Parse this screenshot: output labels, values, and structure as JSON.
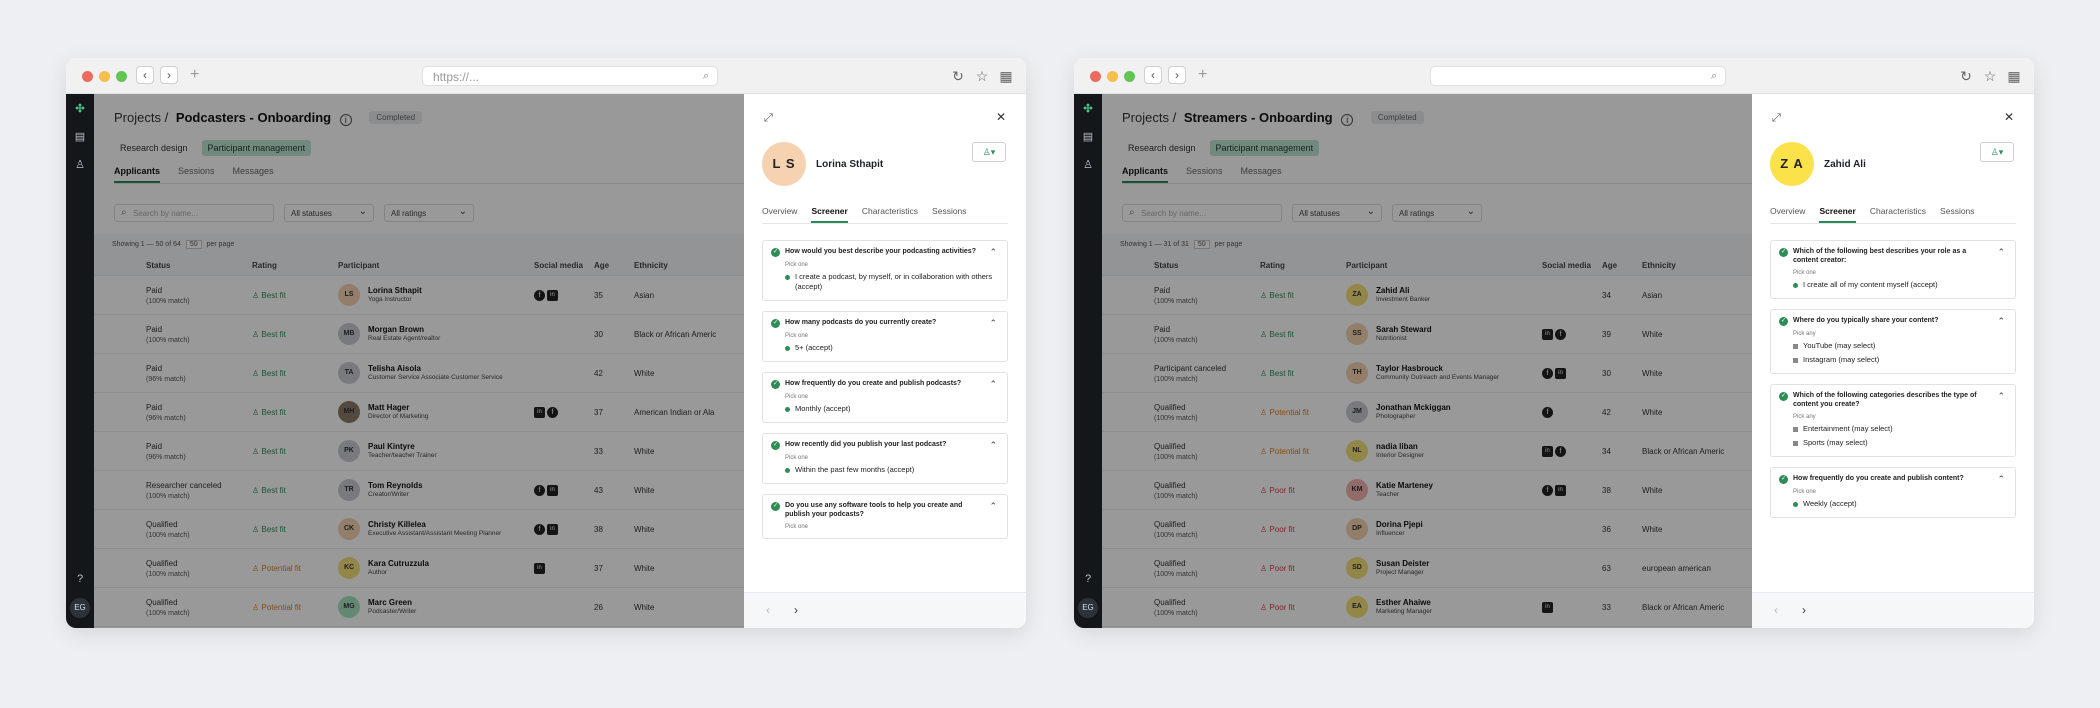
{
  "windows": [
    {
      "url": "https://...",
      "crumb": "Projects /",
      "project": "Podcasters - Onboarding",
      "badge": "Completed",
      "subtabs": [
        "Research design",
        "Participant management"
      ],
      "tabs": [
        "Applicants",
        "Sessions",
        "Messages"
      ],
      "search_placeholder": "Search by name...",
      "status_filter": "All statuses",
      "rating_filter": "All ratings",
      "showing": "Showing 1 — 50 of 64",
      "per_page_value": "50",
      "per_page_label": "per page",
      "columns": [
        "Status",
        "Rating",
        "Participant",
        "Social media",
        "Age",
        "Ethnicity"
      ],
      "rows": [
        {
          "status": "Paid",
          "match": "(100% match)",
          "rating": "Best fit",
          "rating_color": "#2f8c56",
          "initials": "LS",
          "avatar_color": "#f6d2b0",
          "name": "Lorina Sthapit",
          "role": "Yoga Instructor",
          "social": [
            "fb",
            "in"
          ],
          "age": "35",
          "ethnicity": "Asian"
        },
        {
          "status": "Paid",
          "match": "(100% match)",
          "rating": "Best fit",
          "rating_color": "#2f8c56",
          "initials": "MB",
          "avatar_color": "#c9cbd0",
          "name": "Morgan Brown",
          "role": "Real Estate Agent/realtor",
          "social": [],
          "age": "30",
          "ethnicity": "Black or African Americ"
        },
        {
          "status": "Paid",
          "match": "(96% match)",
          "rating": "Best fit",
          "rating_color": "#2f8c56",
          "initials": "TA",
          "avatar_color": "#c9cbd0",
          "name": "Telisha Aisola",
          "role": "Customer Service Associate Customer Service",
          "social": [],
          "age": "42",
          "ethnicity": "White"
        },
        {
          "status": "Paid",
          "match": "(96% match)",
          "rating": "Best fit",
          "rating_color": "#2f8c56",
          "initials": "MH",
          "avatar_color": "#8a7a6a",
          "name": "Matt Hager",
          "role": "Director of Marketing",
          "social": [
            "in",
            "fb"
          ],
          "age": "37",
          "ethnicity": "American Indian or Ala"
        },
        {
          "status": "Paid",
          "match": "(96% match)",
          "rating": "Best fit",
          "rating_color": "#2f8c56",
          "initials": "PK",
          "avatar_color": "#c9cbd0",
          "name": "Paul Kintyre",
          "role": "Teacher/teacher Trainer",
          "social": [],
          "age": "33",
          "ethnicity": "White"
        },
        {
          "status": "Researcher canceled",
          "match": "(100% match)",
          "rating": "Best fit",
          "rating_color": "#2f8c56",
          "initials": "TR",
          "avatar_color": "#c9cbd0",
          "name": "Tom Reynolds",
          "role": "Creator/Writer",
          "social": [
            "fb",
            "in"
          ],
          "age": "43",
          "ethnicity": "White"
        },
        {
          "status": "Qualified",
          "match": "(100% match)",
          "rating": "Best fit",
          "rating_color": "#2f8c56",
          "initials": "CK",
          "avatar_color": "#f6d2b0",
          "name": "Christy Killelea",
          "role": "Executive Assistant/Assistant Meeting Planner",
          "social": [
            "fb",
            "in"
          ],
          "age": "38",
          "ethnicity": "White"
        },
        {
          "status": "Qualified",
          "match": "(100% match)",
          "rating": "Potential fit",
          "rating_color": "#d9822b",
          "initials": "KC",
          "avatar_color": "#f5e07a",
          "name": "Kara Cutruzzula",
          "role": "Author",
          "social": [
            "in"
          ],
          "age": "37",
          "ethnicity": "White"
        },
        {
          "status": "Qualified",
          "match": "(100% match)",
          "rating": "Potential fit",
          "rating_color": "#d9822b",
          "initials": "MG",
          "avatar_color": "#a6e3bf",
          "name": "Marc Green",
          "role": "Podcaster/Writer",
          "social": [],
          "age": "26",
          "ethnicity": "White"
        }
      ],
      "panel": {
        "initials": "L S",
        "avatar_color": "#f6d2b0",
        "name": "Lorina Sthapit",
        "tabs": [
          "Overview",
          "Screener",
          "Characteristics",
          "Sessions"
        ],
        "questions": [
          {
            "q": "How would you best describe your podcasting activities?",
            "pick": "Pick one",
            "type": "one",
            "answers": [
              "I create a podcast, by myself, or in collaboration with others (accept)"
            ]
          },
          {
            "q": "How many podcasts do you currently create?",
            "pick": "Pick one",
            "type": "one",
            "answers": [
              "5+ (accept)"
            ]
          },
          {
            "q": "How frequently do you create and publish podcasts?",
            "pick": "Pick one",
            "type": "one",
            "answers": [
              "Monthly (accept)"
            ]
          },
          {
            "q": "How recently did you publish your last podcast?",
            "pick": "Pick one",
            "type": "one",
            "answers": [
              "Within the past few months (accept)"
            ]
          },
          {
            "q": "Do you use any software tools to help you create and publish your podcasts?",
            "pick": "Pick one",
            "type": "one",
            "answers": []
          }
        ]
      }
    },
    {
      "url": "",
      "crumb": "Projects /",
      "project": "Streamers - Onboarding",
      "badge": "Completed",
      "subtabs": [
        "Research design",
        "Participant management"
      ],
      "tabs": [
        "Applicants",
        "Sessions",
        "Messages"
      ],
      "search_placeholder": "Search by name...",
      "status_filter": "All statuses",
      "rating_filter": "All ratings",
      "showing": "Showing 1 — 31 of 31",
      "per_page_value": "50",
      "per_page_label": "per page",
      "columns": [
        "Status",
        "Rating",
        "Participant",
        "Social media",
        "Age",
        "Ethnicity"
      ],
      "rows": [
        {
          "status": "Paid",
          "match": "(100% match)",
          "rating": "Best fit",
          "rating_color": "#2f8c56",
          "initials": "ZA",
          "avatar_color": "#f5e07a",
          "name": "Zahid Ali",
          "role": "Investment Banker",
          "social": [],
          "age": "34",
          "ethnicity": "Asian"
        },
        {
          "status": "Paid",
          "match": "(100% match)",
          "rating": "Best fit",
          "rating_color": "#2f8c56",
          "initials": "SS",
          "avatar_color": "#f6d2b0",
          "name": "Sarah Steward",
          "role": "Nutritionist",
          "social": [
            "in",
            "fb"
          ],
          "age": "39",
          "ethnicity": "White"
        },
        {
          "status": "Participant canceled",
          "match": "(100% match)",
          "rating": "Best fit",
          "rating_color": "#2f8c56",
          "initials": "TH",
          "avatar_color": "#f6d2b0",
          "name": "Taylor Hasbrouck",
          "role": "Community Outreach and Events Manager",
          "social": [
            "fb",
            "in"
          ],
          "age": "30",
          "ethnicity": "White"
        },
        {
          "status": "Qualified",
          "match": "(100% match)",
          "rating": "Potential fit",
          "rating_color": "#d9822b",
          "initials": "JM",
          "avatar_color": "#c9cbd0",
          "name": "Jonathan Mckiggan",
          "role": "Photographer",
          "social": [
            "fb"
          ],
          "age": "42",
          "ethnicity": "White"
        },
        {
          "status": "Qualified",
          "match": "(100% match)",
          "rating": "Potential fit",
          "rating_color": "#d9822b",
          "initials": "NL",
          "avatar_color": "#f5e07a",
          "name": "nadia liban",
          "role": "Interior Designer",
          "social": [
            "in",
            "fb"
          ],
          "age": "34",
          "ethnicity": "Black or African Americ"
        },
        {
          "status": "Qualified",
          "match": "(100% match)",
          "rating": "Poor fit",
          "rating_color": "#d0453f",
          "initials": "KM",
          "avatar_color": "#f3b3b0",
          "name": "Katie Marteney",
          "role": "Teacher",
          "social": [
            "fb",
            "in"
          ],
          "age": "38",
          "ethnicity": "White"
        },
        {
          "status": "Qualified",
          "match": "(100% match)",
          "rating": "Poor fit",
          "rating_color": "#d0453f",
          "initials": "DP",
          "avatar_color": "#f6d2b0",
          "name": "Dorina Pjepi",
          "role": "Influencer",
          "social": [],
          "age": "36",
          "ethnicity": "White"
        },
        {
          "status": "Qualified",
          "match": "(100% match)",
          "rating": "Poor fit",
          "rating_color": "#d0453f",
          "initials": "SD",
          "avatar_color": "#f5e07a",
          "name": "Susan Deister",
          "role": "Project Manager",
          "social": [],
          "age": "63",
          "ethnicity": "european american"
        },
        {
          "status": "Qualified",
          "match": "(100% match)",
          "rating": "Poor fit",
          "rating_color": "#d0453f",
          "initials": "EA",
          "avatar_color": "#f5e07a",
          "name": "Esther Ahaiwe",
          "role": "Marketing Manager",
          "social": [
            "in"
          ],
          "age": "33",
          "ethnicity": "Black or African Americ"
        }
      ],
      "panel": {
        "initials": "Z A",
        "avatar_color": "#fbe14a",
        "name": "Zahid Ali",
        "tabs": [
          "Overview",
          "Screener",
          "Characteristics",
          "Sessions"
        ],
        "questions": [
          {
            "q": "Which of the following best describes your role as a content creator:",
            "pick": "Pick one",
            "type": "one",
            "answers": [
              "I create all of my content myself (accept)"
            ]
          },
          {
            "q": "Where do you typically share your content?",
            "pick": "Pick any",
            "type": "any",
            "answers": [
              "YouTube (may select)",
              "Instagram (may select)"
            ]
          },
          {
            "q": "Which of the following categories describes the type of content you create?",
            "pick": "Pick any",
            "type": "any",
            "answers": [
              "Entertainment (may select)",
              "Sports (may select)"
            ]
          },
          {
            "q": "How frequently do you create and publish content?",
            "pick": "Pick one",
            "type": "one",
            "answers": [
              "Weekly (accept)"
            ]
          }
        ]
      }
    }
  ]
}
